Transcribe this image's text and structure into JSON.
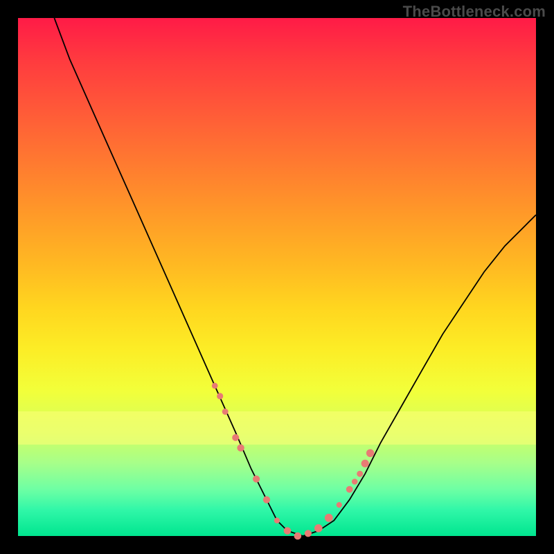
{
  "watermark": "TheBottleneck.com",
  "chart_data": {
    "type": "line",
    "title": "",
    "xlabel": "",
    "ylabel": "",
    "xlim": [
      0,
      100
    ],
    "ylim": [
      0,
      100
    ],
    "series": [
      {
        "name": "bottleneck-curve",
        "x": [
          7,
          10,
          14,
          18,
          22,
          26,
          30,
          34,
          38,
          42,
          45,
          48,
          50,
          52,
          55,
          58,
          61,
          64,
          67,
          70,
          74,
          78,
          82,
          86,
          90,
          94,
          98,
          100
        ],
        "y": [
          100,
          92,
          83,
          74,
          65,
          56,
          47,
          38,
          29,
          20,
          13,
          7,
          3,
          1,
          0,
          1,
          3,
          7,
          12,
          18,
          25,
          32,
          39,
          45,
          51,
          56,
          60,
          62
        ]
      }
    ],
    "marker_points": {
      "name": "highlight-dots",
      "x": [
        38,
        39,
        40,
        42,
        43,
        46,
        48,
        50,
        52,
        54,
        56,
        58,
        60,
        62,
        64,
        65,
        66,
        67,
        68
      ],
      "y": [
        29,
        27,
        24,
        19,
        17,
        11,
        7,
        3,
        1,
        0,
        0.5,
        1.5,
        3.5,
        6,
        9,
        10.5,
        12,
        14,
        16
      ]
    },
    "gradient_stops": [
      {
        "pos": 0,
        "color": "#ff1b47"
      },
      {
        "pos": 18,
        "color": "#ff5a38"
      },
      {
        "pos": 38,
        "color": "#ff9a28"
      },
      {
        "pos": 56,
        "color": "#ffd61f"
      },
      {
        "pos": 72,
        "color": "#f2ff3a"
      },
      {
        "pos": 86,
        "color": "#a6ff8a"
      },
      {
        "pos": 100,
        "color": "#00e58f"
      }
    ],
    "highlight_band": {
      "y0": 18,
      "y1": 24,
      "color": "#faff6a"
    }
  }
}
